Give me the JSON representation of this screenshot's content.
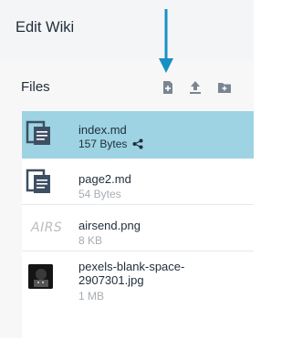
{
  "header": {
    "title": "Edit Wiki"
  },
  "files_panel": {
    "label": "Files",
    "tools": [
      {
        "name": "add-file-icon"
      },
      {
        "name": "upload-icon"
      },
      {
        "name": "add-folder-icon"
      }
    ]
  },
  "files": [
    {
      "name": "index.md",
      "size": "157 Bytes",
      "type": "document",
      "selected": true,
      "shared": true
    },
    {
      "name": "page2.md",
      "size": "54 Bytes",
      "type": "document",
      "selected": false,
      "shared": false
    },
    {
      "name": "airsend.png",
      "size": "8 KB",
      "type": "image-logo",
      "thumb_text": "AIRS",
      "selected": false,
      "shared": false
    },
    {
      "name": "pexels-blank-space-2907301.jpg",
      "name_lines": [
        "pexels-blank-space-",
        "2907301.jpg"
      ],
      "size": "1 MB",
      "type": "image-photo",
      "selected": false,
      "shared": false
    }
  ],
  "colors": {
    "accent": "#1a8fc4",
    "selected_row": "#9dd3e3",
    "icon_gray": "#7a8591",
    "doc_icon": "#3e4f63"
  }
}
